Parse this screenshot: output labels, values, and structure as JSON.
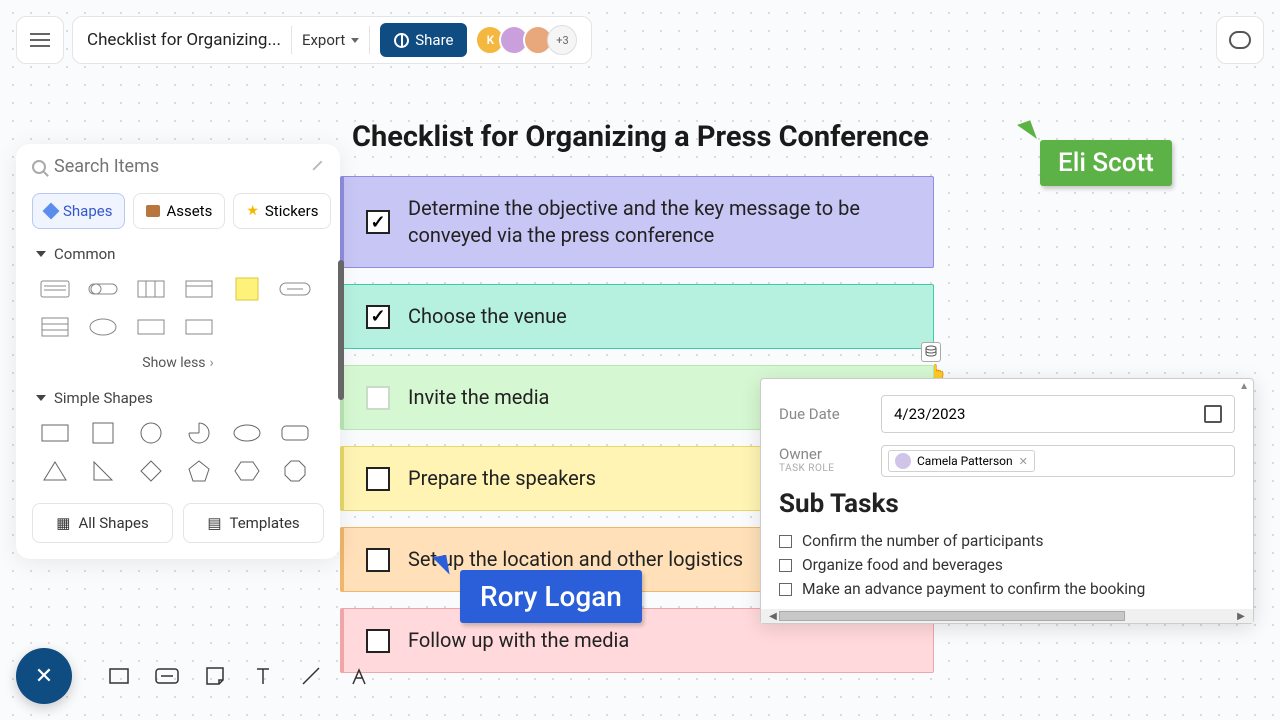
{
  "header": {
    "title": "Checklist for Organizing...",
    "export": "Export",
    "share": "Share",
    "avatar_more": "+3"
  },
  "sidebar": {
    "search_placeholder": "Search Items",
    "tabs": {
      "shapes": "Shapes",
      "assets": "Assets",
      "stickers": "Stickers"
    },
    "sections": {
      "common": "Common",
      "simple": "Simple Shapes"
    },
    "show_less": "Show less",
    "all_shapes": "All Shapes",
    "templates": "Templates"
  },
  "board": {
    "title": "Checklist for Organizing a Press Conference",
    "items": [
      {
        "text": "Determine the objective and the key message to be conveyed via the press conference",
        "checked": true
      },
      {
        "text": "Choose the venue",
        "checked": true
      },
      {
        "text": "Invite the media",
        "checked": false
      },
      {
        "text": "Prepare the speakers",
        "checked": false
      },
      {
        "text": "Set up the location and other logistics",
        "checked": false
      },
      {
        "text": "Follow up with the media",
        "checked": false
      }
    ]
  },
  "cursors": {
    "eli": "Eli Scott",
    "rory": "Rory Logan"
  },
  "detail": {
    "due_label": "Due Date",
    "due_value": "4/23/2023",
    "owner_label": "Owner",
    "owner_sub": "TASK ROLE",
    "owner_name": "Camela Patterson",
    "subtasks_title": "Sub Tasks",
    "subtasks": [
      "Confirm the number of participants",
      "Organize food and beverages",
      "Make an advance payment to confirm the booking"
    ]
  }
}
